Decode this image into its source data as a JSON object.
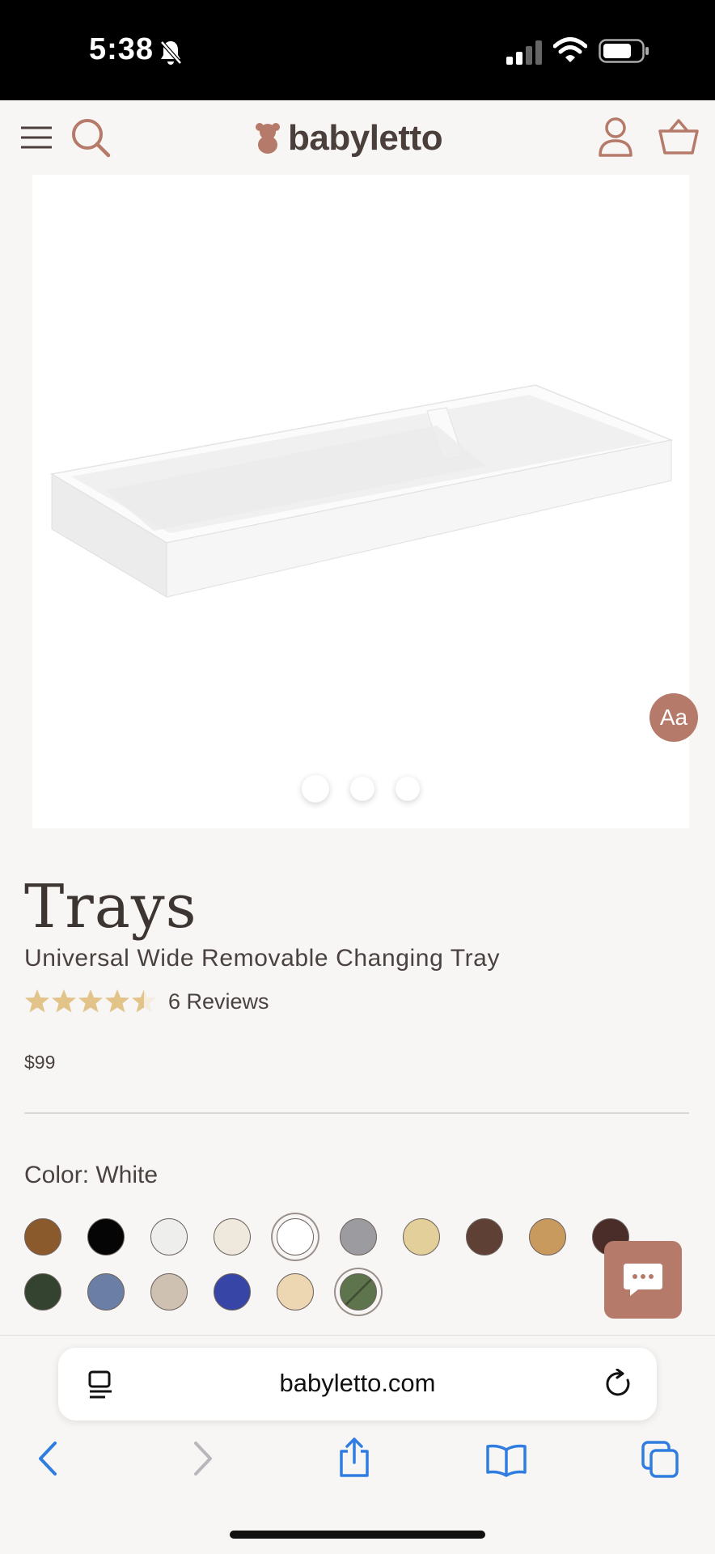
{
  "status_bar": {
    "time": "5:38"
  },
  "header": {
    "brand": "babyletto"
  },
  "gallery": {
    "slide_count": 3,
    "active_slide": 1,
    "accessibility_label": "Aa"
  },
  "product": {
    "title": "Trays",
    "subtitle": "Universal Wide Removable Changing Tray",
    "rating": 4.5,
    "reviews_label": "6 Reviews",
    "price": "$99",
    "color_label": "Color: White"
  },
  "swatches": [
    {
      "color": "#8a5a2c"
    },
    {
      "color": "#050505"
    },
    {
      "color": "#eeeeec"
    },
    {
      "color": "#eee8dd"
    },
    {
      "color": "#ffffff",
      "selected": true
    },
    {
      "color": "#9c9ba0"
    },
    {
      "color": "#e3cf9a"
    },
    {
      "color": "#5e4034"
    },
    {
      "color": "#c89a5e"
    },
    {
      "color": "#4a2c28"
    },
    {
      "color": "#34432f"
    },
    {
      "color": "#6b7ea6"
    },
    {
      "color": "#cfc1b2"
    },
    {
      "color": "#3745a6"
    },
    {
      "color": "#ecd7b2"
    },
    {
      "color": "#5e744c",
      "selected": true
    }
  ],
  "browser": {
    "url": "babyletto.com"
  },
  "colors": {
    "brand_accent": "#b57a6a",
    "star": "#e2c48a",
    "ios_blue": "#2f7de1"
  }
}
